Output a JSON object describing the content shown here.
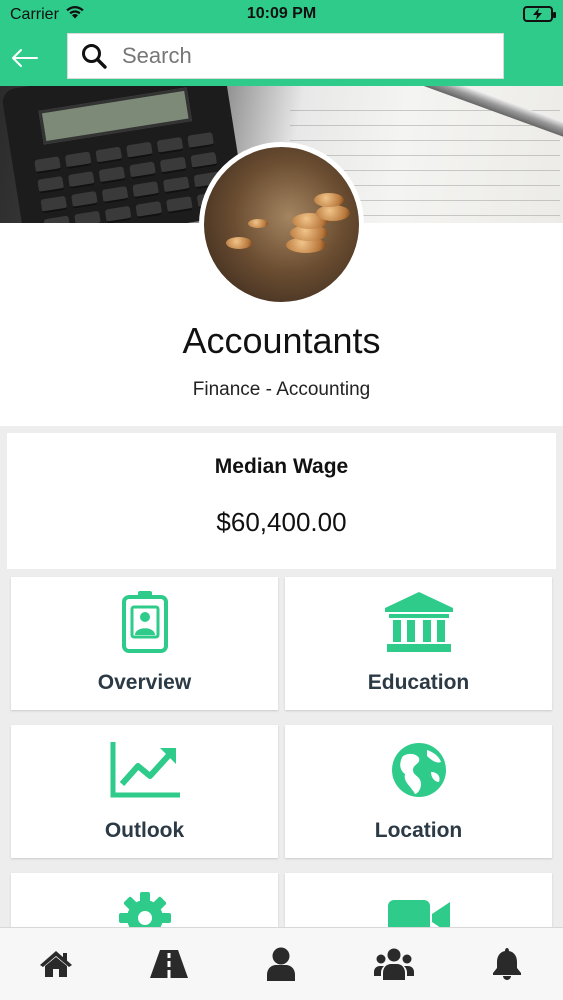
{
  "status_bar": {
    "carrier": "Carrier",
    "time": "10:09 PM"
  },
  "header": {
    "search_placeholder": "Search"
  },
  "profile": {
    "title": "Accountants",
    "category": "Finance - Accounting"
  },
  "wage": {
    "label": "Median Wage",
    "value": "$60,400.00"
  },
  "tiles": [
    {
      "label": "Overview",
      "icon": "id-badge-icon"
    },
    {
      "label": "Education",
      "icon": "bank-icon"
    },
    {
      "label": "Outlook",
      "icon": "trend-chart-icon"
    },
    {
      "label": "Location",
      "icon": "globe-icon"
    },
    {
      "label": "",
      "icon": "gear-icon"
    },
    {
      "label": "",
      "icon": "video-camera-icon"
    }
  ],
  "tabbar": [
    "home-icon",
    "road-icon",
    "user-icon",
    "users-icon",
    "bell-icon"
  ],
  "colors": {
    "accent": "#2ecb8a",
    "tile_text": "#2b3a45",
    "background": "#ededed"
  }
}
